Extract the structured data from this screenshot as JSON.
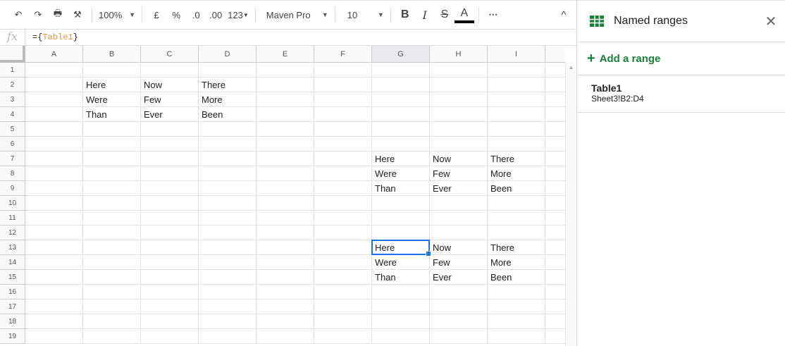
{
  "toolbar": {
    "zoom": "100%",
    "currency": "£",
    "percent": "%",
    "dec_less": ".0",
    "dec_more": ".00",
    "format": "123",
    "font": "Maven Pro",
    "font_size": "10",
    "bold": "B",
    "italic": "I",
    "strike": "S",
    "text_color": "A",
    "more": "⋯",
    "collapse": "^"
  },
  "formula": {
    "prefix": "={",
    "ref": "Table1",
    "suffix": "}"
  },
  "fx": "fx",
  "columns": [
    "A",
    "B",
    "C",
    "D",
    "E",
    "F",
    "G",
    "H",
    "I"
  ],
  "rows": [
    "1",
    "2",
    "3",
    "4",
    "5",
    "6",
    "7",
    "8",
    "9",
    "10",
    "11",
    "12",
    "13",
    "14",
    "15",
    "16",
    "17",
    "18",
    "19"
  ],
  "selected": "G13",
  "cells": [
    {
      "ref": "B2",
      "v": "Here"
    },
    {
      "ref": "C2",
      "v": "Now"
    },
    {
      "ref": "D2",
      "v": "There"
    },
    {
      "ref": "B3",
      "v": "Were"
    },
    {
      "ref": "C3",
      "v": "Few"
    },
    {
      "ref": "D3",
      "v": "More"
    },
    {
      "ref": "B4",
      "v": "Than"
    },
    {
      "ref": "C4",
      "v": "Ever"
    },
    {
      "ref": "D4",
      "v": "Been"
    },
    {
      "ref": "G7",
      "v": "Here"
    },
    {
      "ref": "H7",
      "v": "Now"
    },
    {
      "ref": "I7",
      "v": "There"
    },
    {
      "ref": "G8",
      "v": "Were"
    },
    {
      "ref": "H8",
      "v": "Few"
    },
    {
      "ref": "I8",
      "v": "More"
    },
    {
      "ref": "G9",
      "v": "Than"
    },
    {
      "ref": "H9",
      "v": "Ever"
    },
    {
      "ref": "I9",
      "v": "Been"
    },
    {
      "ref": "G13",
      "v": "Here"
    },
    {
      "ref": "H13",
      "v": "Now"
    },
    {
      "ref": "I13",
      "v": "There"
    },
    {
      "ref": "G14",
      "v": "Were"
    },
    {
      "ref": "H14",
      "v": "Few"
    },
    {
      "ref": "I14",
      "v": "More"
    },
    {
      "ref": "G15",
      "v": "Than"
    },
    {
      "ref": "H15",
      "v": "Ever"
    },
    {
      "ref": "I15",
      "v": "Been"
    }
  ],
  "sidebar": {
    "title": "Named ranges",
    "add_label": "Add a range",
    "ranges": [
      {
        "name": "Table1",
        "range": "Sheet3!B2:D4"
      }
    ]
  },
  "colors": {
    "accent": "#188038",
    "selection": "#1a73e8"
  }
}
